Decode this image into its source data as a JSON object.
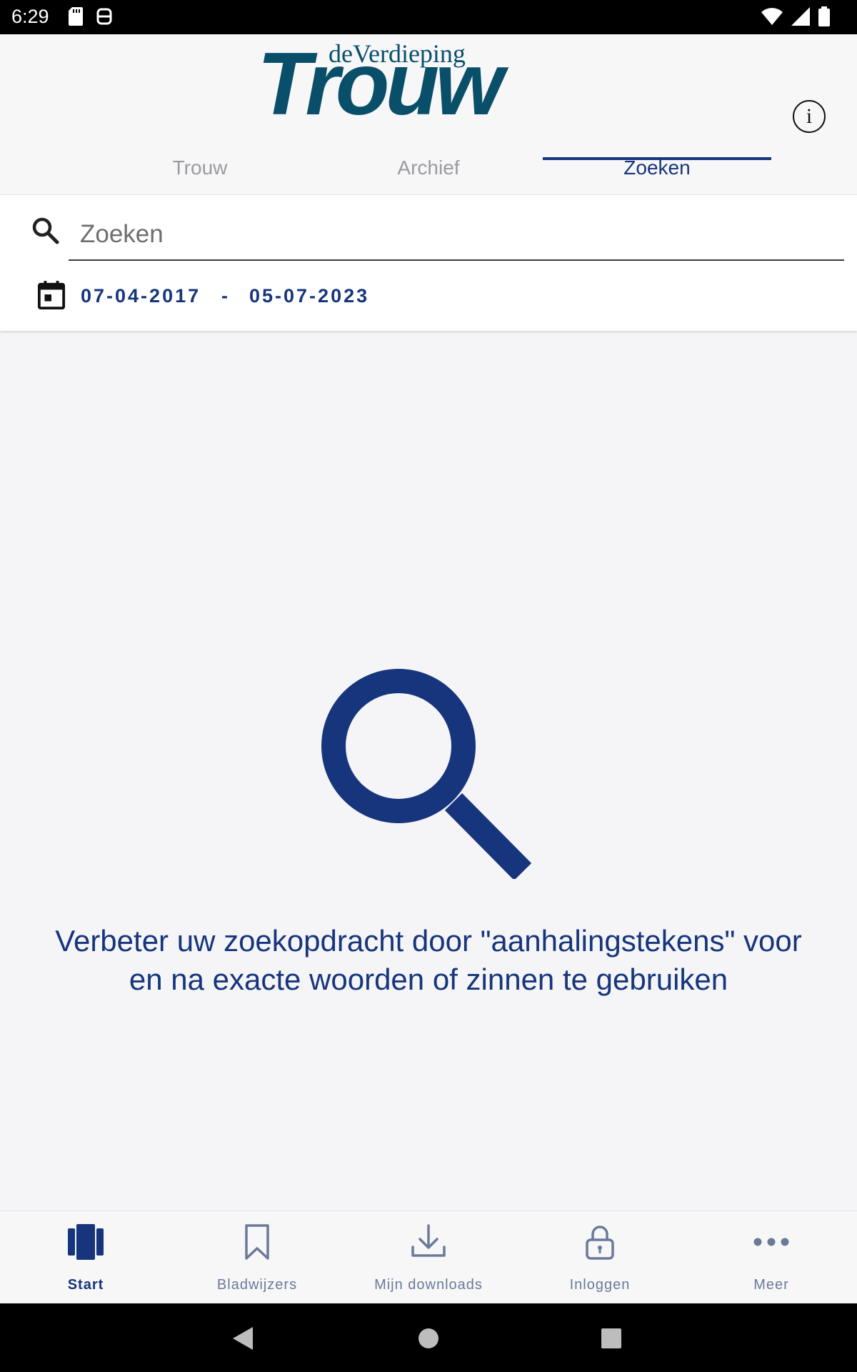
{
  "status_bar": {
    "time": "6:29"
  },
  "header": {
    "logo_sub": "deVerdieping",
    "logo_main": "Trouw",
    "info_glyph": "i",
    "tabs": [
      {
        "label": "Trouw",
        "active": false
      },
      {
        "label": "Archief",
        "active": false
      },
      {
        "label": "Zoeken",
        "active": true
      }
    ]
  },
  "search": {
    "placeholder": "Zoeken",
    "date_from": "07-04-2017",
    "date_separator": "-",
    "date_to": "05-07-2023"
  },
  "empty_state": {
    "icon": "magnifier-icon",
    "hint_line1": "Verbeter uw zoekopdracht door \"aanhalingstekens\" voor",
    "hint_line2": "en na exacte woorden of zinnen te gebruiken"
  },
  "bottom_nav": {
    "items": [
      {
        "label": "Start",
        "icon": "start-icon",
        "active": true
      },
      {
        "label": "Bladwijzers",
        "icon": "bookmark-icon",
        "active": false
      },
      {
        "label": "Mijn downloads",
        "icon": "download-icon",
        "active": false
      },
      {
        "label": "Inloggen",
        "icon": "lock-icon",
        "active": false
      },
      {
        "label": "Meer",
        "icon": "more-icon",
        "active": false
      }
    ]
  },
  "colors": {
    "brand": "#0a4f6a",
    "accent": "#16357c",
    "inactive": "#9a9aa0"
  }
}
